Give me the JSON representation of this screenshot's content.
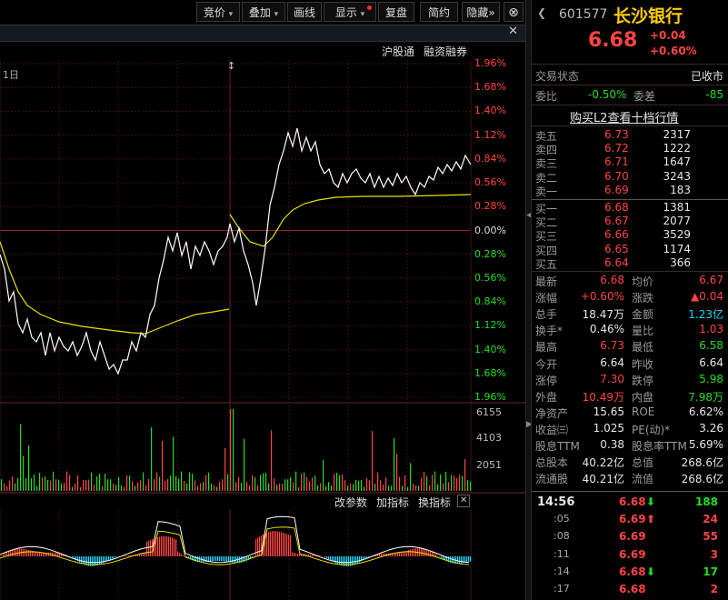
{
  "toolbar": {
    "buttons": [
      "竞价",
      "叠加",
      "画线",
      "显示",
      "复盘",
      "简约",
      "隐藏"
    ],
    "close_glyph": "⊗",
    "dropdown_glyph": "▾",
    "expand_glyph": "»"
  },
  "chart": {
    "period_label": "1日",
    "close_x": "✕",
    "links": [
      "沪股通",
      "融资融券"
    ],
    "pct_ticks_up": [
      "1.96%",
      "1.68%",
      "1.40%",
      "1.12%",
      "0.84%",
      "0.56%",
      "0.28%"
    ],
    "zero_tick": "0.00%",
    "pct_ticks_down": [
      "0.28%",
      "0.56%",
      "0.84%",
      "1.12%",
      "1.40%",
      "1.68%",
      "1.96%"
    ],
    "volume_ticks": [
      "6155",
      "4103",
      "2051"
    ],
    "indicator_bar": {
      "modify": "改参数",
      "add": "加指标",
      "switch": "换指标",
      "close": "✕"
    },
    "colors": {
      "up": "#ff4444",
      "down": "#22dd22",
      "price_line": "#ffffff",
      "avg_line": "#e8e000",
      "grid": "#5a1a1a"
    }
  },
  "quote": {
    "code": "601577",
    "name": "长沙银行",
    "price": "6.68",
    "change": "+0.04",
    "change_pct": "+0.60%",
    "trade_status_label": "交易状态",
    "trade_status": "已收市",
    "weibi_label": "委比",
    "weibi": "-0.50%",
    "weicha_label": "委差",
    "weicha": "-85",
    "l2_link": "购买L2查看十档行情",
    "asks": [
      {
        "label": "卖五",
        "price": "6.73",
        "vol": "2317"
      },
      {
        "label": "卖四",
        "price": "6.72",
        "vol": "1222"
      },
      {
        "label": "卖三",
        "price": "6.71",
        "vol": "1647"
      },
      {
        "label": "卖二",
        "price": "6.70",
        "vol": "3243"
      },
      {
        "label": "卖一",
        "price": "6.69",
        "vol": "183"
      }
    ],
    "bids": [
      {
        "label": "买一",
        "price": "6.68",
        "vol": "1381"
      },
      {
        "label": "买二",
        "price": "6.67",
        "vol": "2077"
      },
      {
        "label": "买三",
        "price": "6.66",
        "vol": "3529"
      },
      {
        "label": "买四",
        "price": "6.65",
        "vol": "1174"
      },
      {
        "label": "买五",
        "price": "6.64",
        "vol": "366"
      }
    ],
    "stats": [
      {
        "l1": "最新",
        "v1": "6.68",
        "c1": "red",
        "l2": "均价",
        "v2": "6.67",
        "c2": "red"
      },
      {
        "l1": "涨幅",
        "v1": "+0.60%",
        "c1": "red",
        "l2": "涨跌",
        "v2": "▲0.04",
        "c2": "red"
      },
      {
        "l1": "总手",
        "v1": "18.47万",
        "c1": "white",
        "l2": "金额",
        "v2": "1.23亿",
        "c2": "cyan"
      },
      {
        "l1": "换手*",
        "v1": "0.46%",
        "c1": "white",
        "l2": "量比",
        "v2": "1.03",
        "c2": "red"
      },
      {
        "l1": "最高",
        "v1": "6.73",
        "c1": "red",
        "l2": "最低",
        "v2": "6.58",
        "c2": "green"
      },
      {
        "l1": "今开",
        "v1": "6.64",
        "c1": "white",
        "l2": "昨收",
        "v2": "6.64",
        "c2": "white"
      },
      {
        "l1": "涨停",
        "v1": "7.30",
        "c1": "red",
        "l2": "跌停",
        "v2": "5.98",
        "c2": "green"
      },
      {
        "l1": "外盘",
        "v1": "10.49万",
        "c1": "red",
        "l2": "内盘",
        "v2": "7.98万",
        "c2": "green"
      },
      {
        "l1": "净资产",
        "v1": "15.65",
        "c1": "white",
        "l2": "ROE",
        "v2": "6.62%",
        "c2": "white"
      },
      {
        "l1": "收益㈢",
        "v1": "1.025",
        "c1": "white",
        "l2": "PE(动)*",
        "v2": "3.26",
        "c2": "white"
      },
      {
        "l1": "股息TTM",
        "v1": "0.38",
        "c1": "white",
        "l2": "股息率TTM",
        "v2": "5.69%",
        "c2": "white"
      },
      {
        "l1": "总股本",
        "v1": "40.22亿",
        "c1": "white",
        "l2": "总值",
        "v2": "268.6亿",
        "c2": "white"
      },
      {
        "l1": "流通股",
        "v1": "40.21亿",
        "c1": "white",
        "l2": "流值",
        "v2": "268.6亿",
        "c2": "white"
      }
    ],
    "ticks": [
      {
        "time": "14:56",
        "price": "6.68",
        "arrow": "⬇",
        "arrow_color": "green",
        "vol": "188"
      },
      {
        "time": ":05",
        "price": "6.69",
        "arrow": "⬆",
        "arrow_color": "red",
        "vol": "24"
      },
      {
        "time": ":08",
        "price": "6.69",
        "arrow": "",
        "arrow_color": "",
        "vol": "55"
      },
      {
        "time": ":11",
        "price": "6.69",
        "arrow": "",
        "arrow_color": "",
        "vol": "3"
      },
      {
        "time": ":14",
        "price": "6.68",
        "arrow": "⬇",
        "arrow_color": "green",
        "vol": "17"
      },
      {
        "time": ":17",
        "price": "6.68",
        "arrow": "",
        "arrow_color": "",
        "vol": "2"
      }
    ]
  }
}
